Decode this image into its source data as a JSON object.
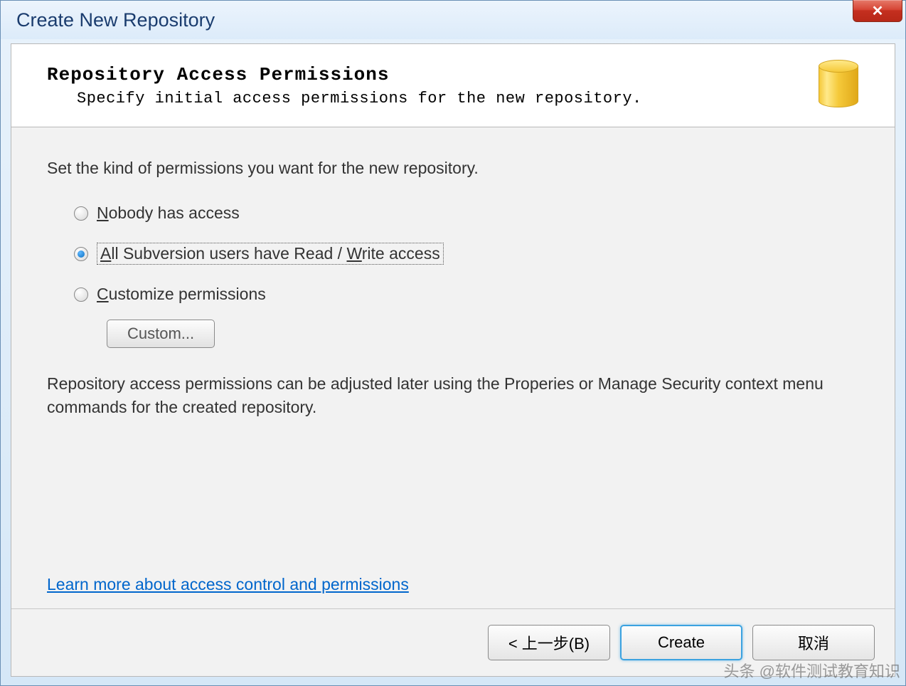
{
  "window": {
    "title": "Create New Repository"
  },
  "header": {
    "title": "Repository Access Permissions",
    "subtitle": "Specify initial access permissions for the new repository."
  },
  "body": {
    "intro": "Set the kind of permissions you want for the new repository.",
    "options": {
      "nobody_prefix": "N",
      "nobody_rest": "obody has access",
      "all_prefix": "A",
      "all_mid": "ll Subversion users have Read / ",
      "all_w": "W",
      "all_rest": "rite access",
      "custom_prefix": "C",
      "custom_rest": "ustomize permissions"
    },
    "custom_button": "Custom...",
    "note": "Repository access permissions can be adjusted later using the Properies or Manage Security context menu commands for the created repository.",
    "link": "Learn more about access control and permissions"
  },
  "footer": {
    "back": "< 上一步(B)",
    "create": "Create",
    "cancel": "取消"
  },
  "watermark": "头条 @软件测试教育知识"
}
